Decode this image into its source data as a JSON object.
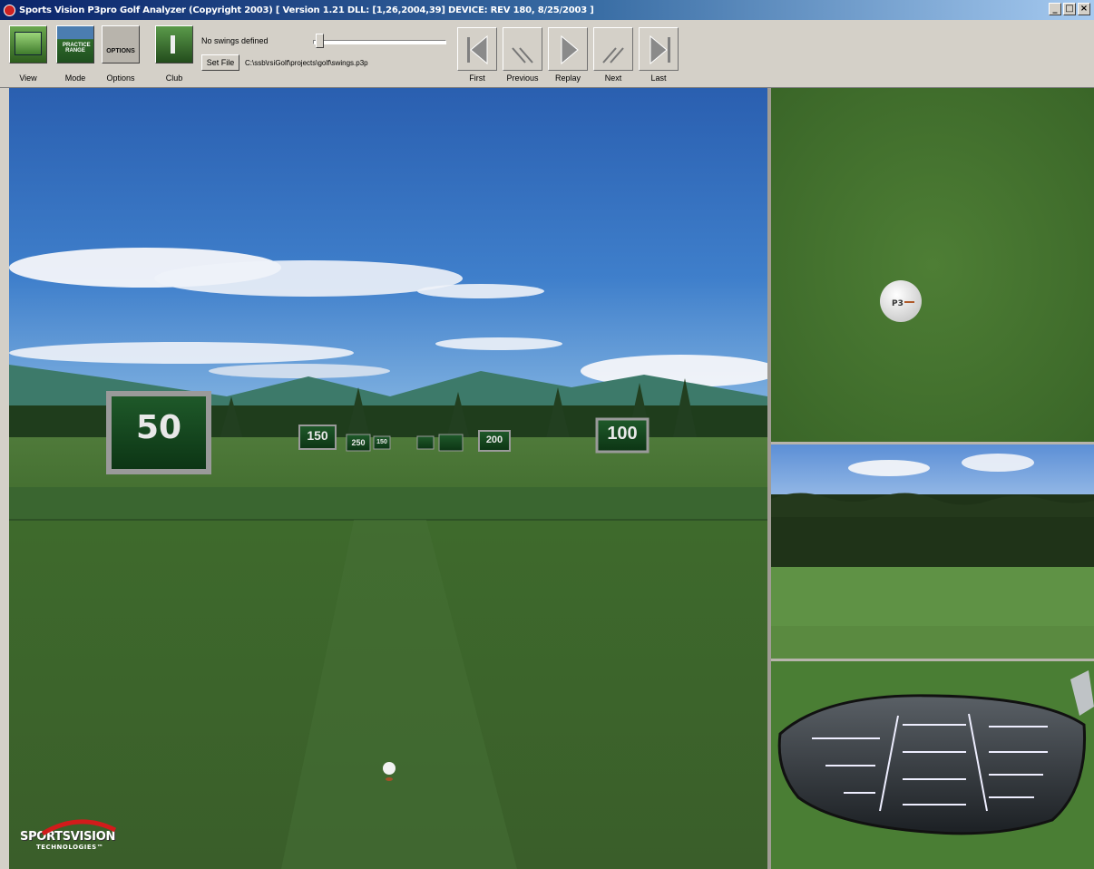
{
  "window": {
    "title": "Sports Vision P3pro Golf Analyzer (Copyright 2003)   [ Version 1.21  DLL: [1,26,2004,39]  DEVICE: REV 180, 8/25/2003 ]",
    "controls": [
      "_",
      "□",
      "×"
    ]
  },
  "toolbar": {
    "view_label": "View",
    "mode_label": "Mode",
    "mode_icon_text": "PRACTICE RANGE",
    "options_label": "Options",
    "options_icon_text": "OPTIONS",
    "club_label": "Club",
    "swings_status": "No swings defined",
    "setfile_label": "Set File",
    "file_path": "C:\\ssb\\rsiGolf\\projects\\golf\\swings.p3p",
    "slider_value": 0,
    "nav": {
      "first": "First",
      "previous": "Previous",
      "replay": "Replay",
      "next": "Next",
      "last": "Last"
    }
  },
  "scene": {
    "distance_markers": [
      "50",
      "150",
      "250",
      "150",
      "200",
      "100"
    ],
    "logo_line1": "SPORTSVISION",
    "logo_line2": "TECHNOLOGIES™"
  },
  "side_panels": {
    "top": "ball-top-view",
    "middle": "flight-view",
    "bottom": "club-face-view"
  },
  "colors": {
    "sky_top": "#2f63b5",
    "grass": "#3e6a2c",
    "titlebar": "#0a246a"
  }
}
